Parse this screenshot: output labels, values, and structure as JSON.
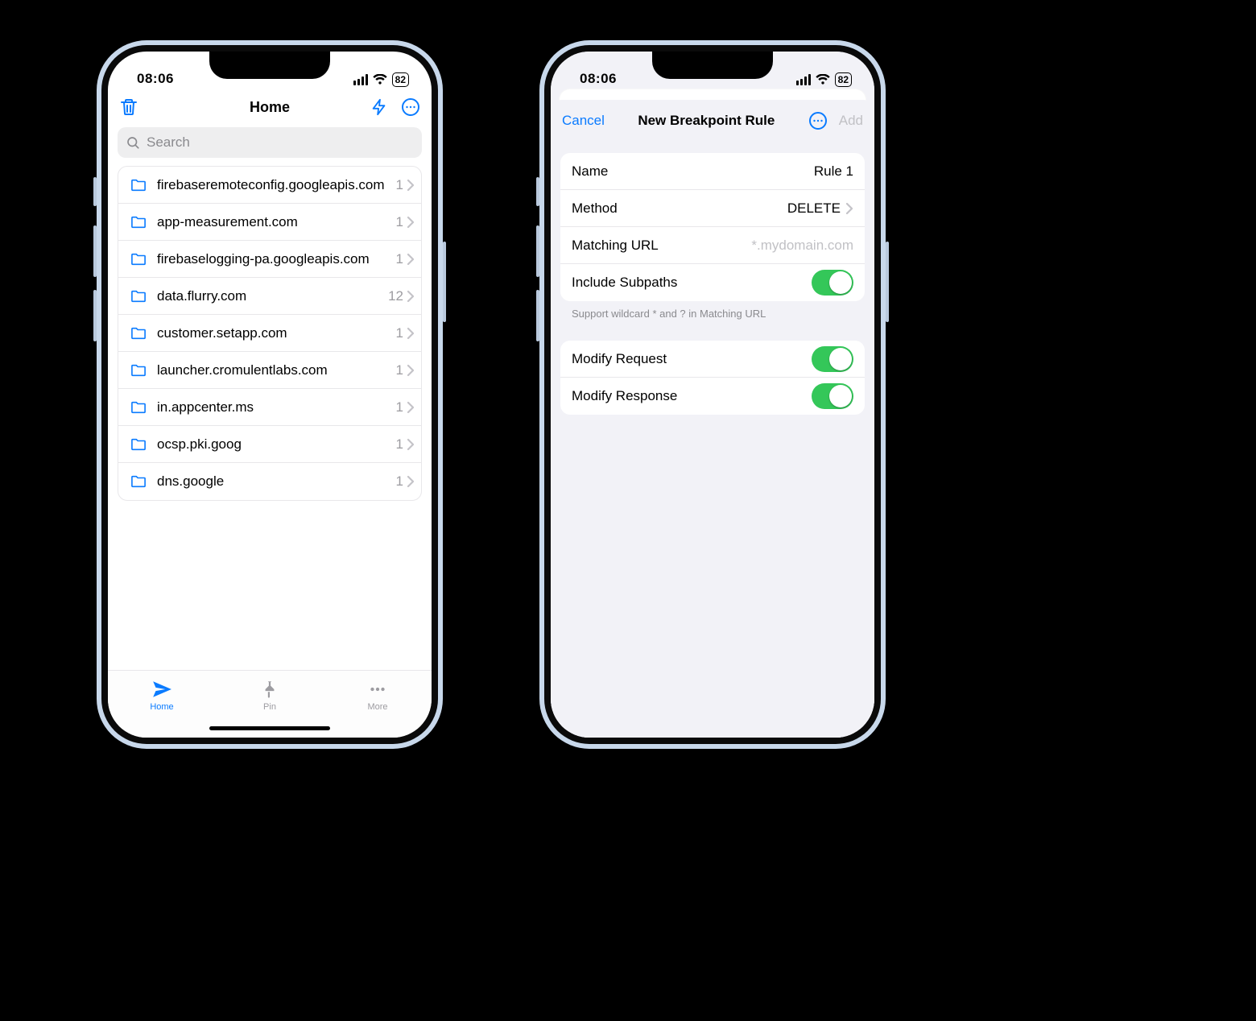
{
  "status": {
    "time": "08:06",
    "battery": "82"
  },
  "screen1": {
    "title": "Home",
    "search_placeholder": "Search",
    "items": [
      {
        "label": "firebaseremoteconfig.googleapis.com",
        "count": "1"
      },
      {
        "label": "app-measurement.com",
        "count": "1"
      },
      {
        "label": "firebaselogging-pa.googleapis.com",
        "count": "1"
      },
      {
        "label": "data.flurry.com",
        "count": "12"
      },
      {
        "label": "customer.setapp.com",
        "count": "1"
      },
      {
        "label": "launcher.cromulentlabs.com",
        "count": "1"
      },
      {
        "label": "in.appcenter.ms",
        "count": "1"
      },
      {
        "label": "ocsp.pki.goog",
        "count": "1"
      },
      {
        "label": "dns.google",
        "count": "1"
      }
    ],
    "tabs": {
      "home": "Home",
      "pin": "Pin",
      "more": "More"
    }
  },
  "screen2": {
    "cancel": "Cancel",
    "title": "New Breakpoint Rule",
    "add": "Add",
    "rows": {
      "name_label": "Name",
      "name_value": "Rule 1",
      "method_label": "Method",
      "method_value": "DELETE",
      "url_label": "Matching URL",
      "url_placeholder": "*.mydomain.com",
      "subpaths_label": "Include Subpaths",
      "note": "Support wildcard * and ? in Matching URL",
      "modreq_label": "Modify Request",
      "modres_label": "Modify Response"
    }
  }
}
